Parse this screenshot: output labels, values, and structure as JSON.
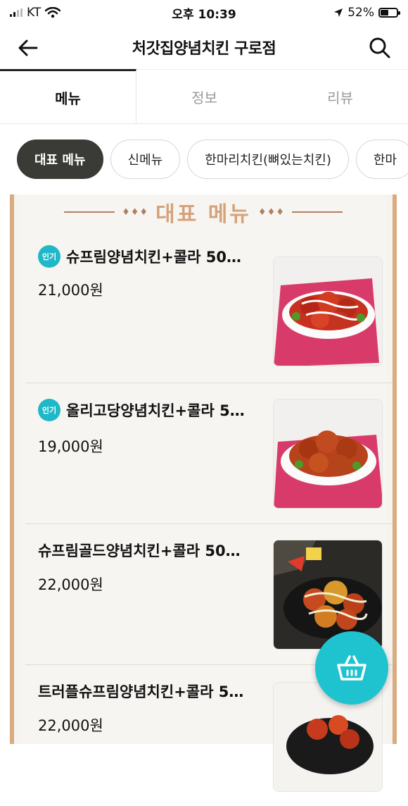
{
  "status_bar": {
    "carrier": "KT",
    "time": "오후 10:39",
    "battery_text": "52%",
    "battery_level": 0.52
  },
  "header": {
    "title": "처갓집양념치킨 구로점",
    "back_icon": "arrow-left-icon",
    "search_icon": "search-icon"
  },
  "tabs": [
    {
      "label": "메뉴",
      "active": true
    },
    {
      "label": "정보",
      "active": false
    },
    {
      "label": "리뷰",
      "active": false
    }
  ],
  "chips": [
    {
      "label": "대표 메뉴",
      "active": true
    },
    {
      "label": "신메뉴",
      "active": false
    },
    {
      "label": "한마리치킨(뼈있는치킨)",
      "active": false
    },
    {
      "label": "한마",
      "active": false
    }
  ],
  "section": {
    "title": "대표 메뉴",
    "ornament_left": "♦♦♦",
    "ornament_right": "♦♦♦"
  },
  "menu_items": [
    {
      "badge": "인기",
      "name": "슈프림양념치킨+콜라 50…",
      "price": "21,000원"
    },
    {
      "badge": "인기",
      "name": "올리고당양념치킨+콜라 5…",
      "price": "19,000원"
    },
    {
      "badge": "",
      "name": "슈프림골드양념치킨+콜라 50…",
      "price": "22,000원"
    },
    {
      "badge": "",
      "name": "트러플슈프림양념치킨+콜라 5…",
      "price": "22,000원"
    }
  ],
  "colors": {
    "accent": "#1fc3cf",
    "board_border": "#d8ac80",
    "section_title": "#d5a27a",
    "chip_active_bg": "#3a3b37"
  },
  "fab": {
    "icon": "basket-icon"
  }
}
